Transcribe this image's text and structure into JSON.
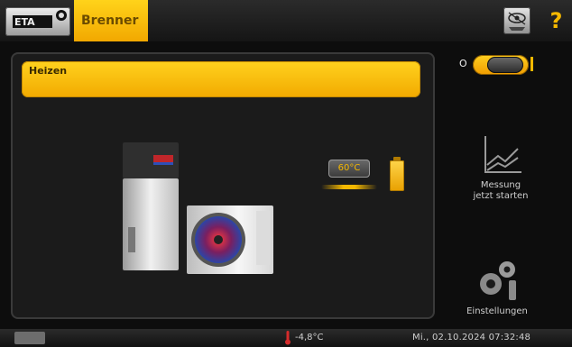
{
  "top_bar": {
    "logo_text": "ETA",
    "active_tab": "Brenner",
    "eye_icon": "view-icon",
    "help_label": "?"
  },
  "main_panel": {
    "title": "Heizen",
    "temperature_display": "60°C"
  },
  "toggle": {
    "off_label": "O",
    "on_marker": "I",
    "state": "on"
  },
  "right_actions": {
    "measure_label_line1": "Messung",
    "measure_label_line2": "jetzt starten",
    "settings_label": "Einstellungen"
  },
  "status_bar": {
    "outside_temperature": "-4,8°C",
    "datetime": "Mi., 02.10.2024 07:32:48"
  },
  "colors": {
    "accent": "#f5b800",
    "background": "#0d0d0d",
    "panel": "#1b1b1b"
  }
}
